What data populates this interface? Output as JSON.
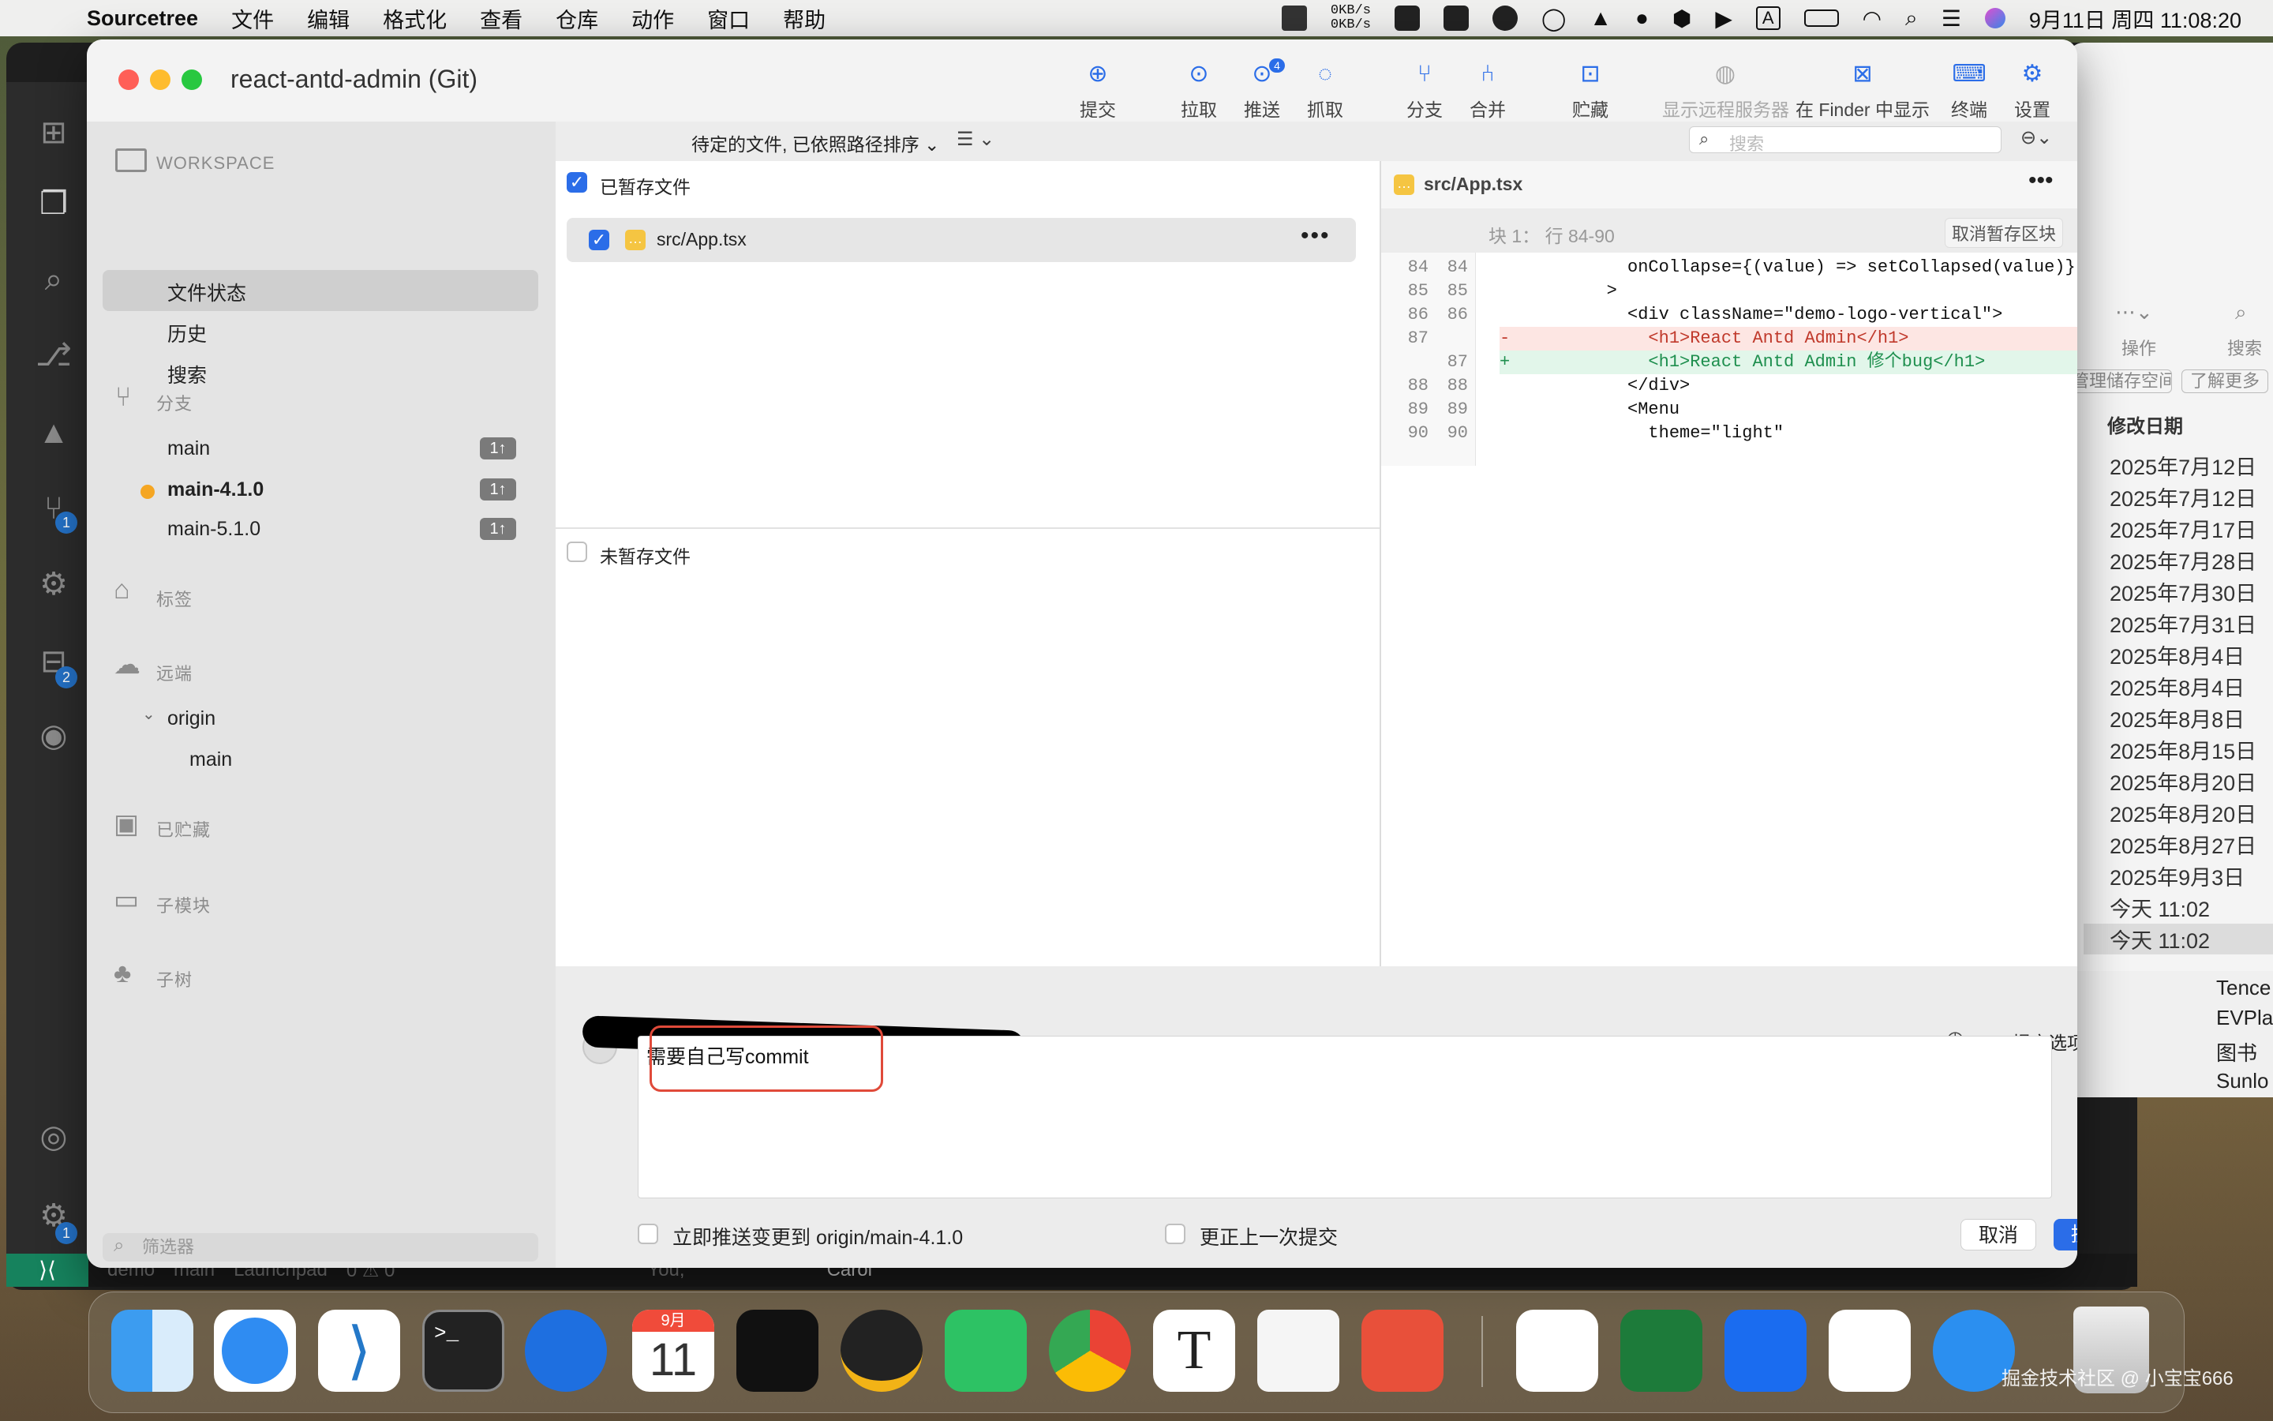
{
  "menubar": {
    "app_name": "Sourcetree",
    "items": [
      "文件",
      "编辑",
      "格式化",
      "查看",
      "仓库",
      "动作",
      "窗口",
      "帮助"
    ],
    "net_up": "0KB/s",
    "net_down": "0KB/s",
    "datetime": "9月11日 周四 11:08:20",
    "input_method": "A"
  },
  "vscode_status": {
    "branch_items": [
      "demo",
      "main",
      "Launchpad"
    ],
    "problems": "0 ⚠ 0",
    "user": "You,"
  },
  "vscode_badges": {
    "source_control": "1",
    "extensions": "2",
    "settings": "1"
  },
  "window": {
    "title": "react-antd-admin (Git)"
  },
  "toolbar": {
    "commit": "提交",
    "pull": "拉取",
    "push": "推送",
    "push_badge": "4",
    "fetch": "抓取",
    "branch": "分支",
    "merge": "合并",
    "stash": "贮藏",
    "show_remote": "显示远程服务器",
    "show_in_finder": "在 Finder 中显示",
    "terminal": "终端",
    "settings": "设置"
  },
  "sidebar": {
    "workspace_header": "WORKSPACE",
    "workspace_items": [
      "文件状态",
      "历史",
      "搜索"
    ],
    "branches_header": "分支",
    "branches": [
      {
        "name": "main",
        "badge": "1↑"
      },
      {
        "name": "main-4.1.0",
        "badge": "1↑"
      },
      {
        "name": "main-5.1.0",
        "badge": "1↑"
      }
    ],
    "tags_header": "标签",
    "remotes_header": "远端",
    "remote_origin": "origin",
    "remote_branch": "main",
    "stashes_header": "已贮藏",
    "submodules_header": "子模块",
    "subtrees_header": "子树",
    "filter_placeholder": "筛选器"
  },
  "file_list": {
    "sort_label": "待定的文件, 已依照路径排序",
    "search_placeholder": "搜索",
    "staged_label": "已暂存文件",
    "staged_files": [
      "src/App.tsx"
    ],
    "unstaged_label": "未暂存文件"
  },
  "diff": {
    "file": "src/App.tsx",
    "hunk_label": "块 1： 行 84-90",
    "unstage_hunk": "取消暂存区块",
    "lines": [
      {
        "old": "84",
        "new": "84",
        "sign": "",
        "text": "          onCollapse={(value) => setCollapsed(value)}",
        "kind": "ctx"
      },
      {
        "old": "85",
        "new": "85",
        "sign": "",
        "text": "        >",
        "kind": "ctx"
      },
      {
        "old": "86",
        "new": "86",
        "sign": "",
        "text": "          <div className=\"demo-logo-vertical\">",
        "kind": "ctx"
      },
      {
        "old": "87",
        "new": "",
        "sign": "-",
        "text": "            <h1>React Antd Admin</h1>",
        "kind": "del"
      },
      {
        "old": "",
        "new": "87",
        "sign": "+",
        "text": "            <h1>React Antd Admin 修个bug</h1>",
        "kind": "add"
      },
      {
        "old": "88",
        "new": "88",
        "sign": "",
        "text": "          </div>",
        "kind": "ctx"
      },
      {
        "old": "89",
        "new": "89",
        "sign": "",
        "text": "          <Menu",
        "kind": "ctx"
      },
      {
        "old": "90",
        "new": "90",
        "sign": "",
        "text": "            theme=\"light\"",
        "kind": "ctx"
      }
    ]
  },
  "commit": {
    "message": "需要自己写commit",
    "options_label": "提交选项...",
    "push_immediately": "立即推送变更到 origin/main-4.1.0",
    "amend_last": "更正上一次提交",
    "cancel": "取消",
    "submit": "提交"
  },
  "finder": {
    "actions_label": "操作",
    "search_label": "搜索",
    "manage_storage": "管理储存空间",
    "learn_more": "了解更多",
    "column_header": "修改日期",
    "dates": [
      "2025年7月12日",
      "2025年7月12日",
      "2025年7月17日",
      "2025年7月28日",
      "2025年7月30日",
      "2025年7月31日",
      "2025年8月4日",
      "2025年8月4日",
      "2025年8月8日",
      "2025年8月15日",
      "2025年8月20日",
      "2025年8月20日",
      "2025年8月27日",
      "2025年9月3日",
      "今天 11:02",
      "今天 11:02"
    ],
    "sidebar_items": [
      "Tence",
      "EVPlay",
      "图书",
      "Sunlo"
    ]
  },
  "bottom_label": "Carol",
  "dock_calendar": {
    "month": "9月",
    "day": "11"
  },
  "watermark": "掘金技术社区 @ 小宝宝666"
}
